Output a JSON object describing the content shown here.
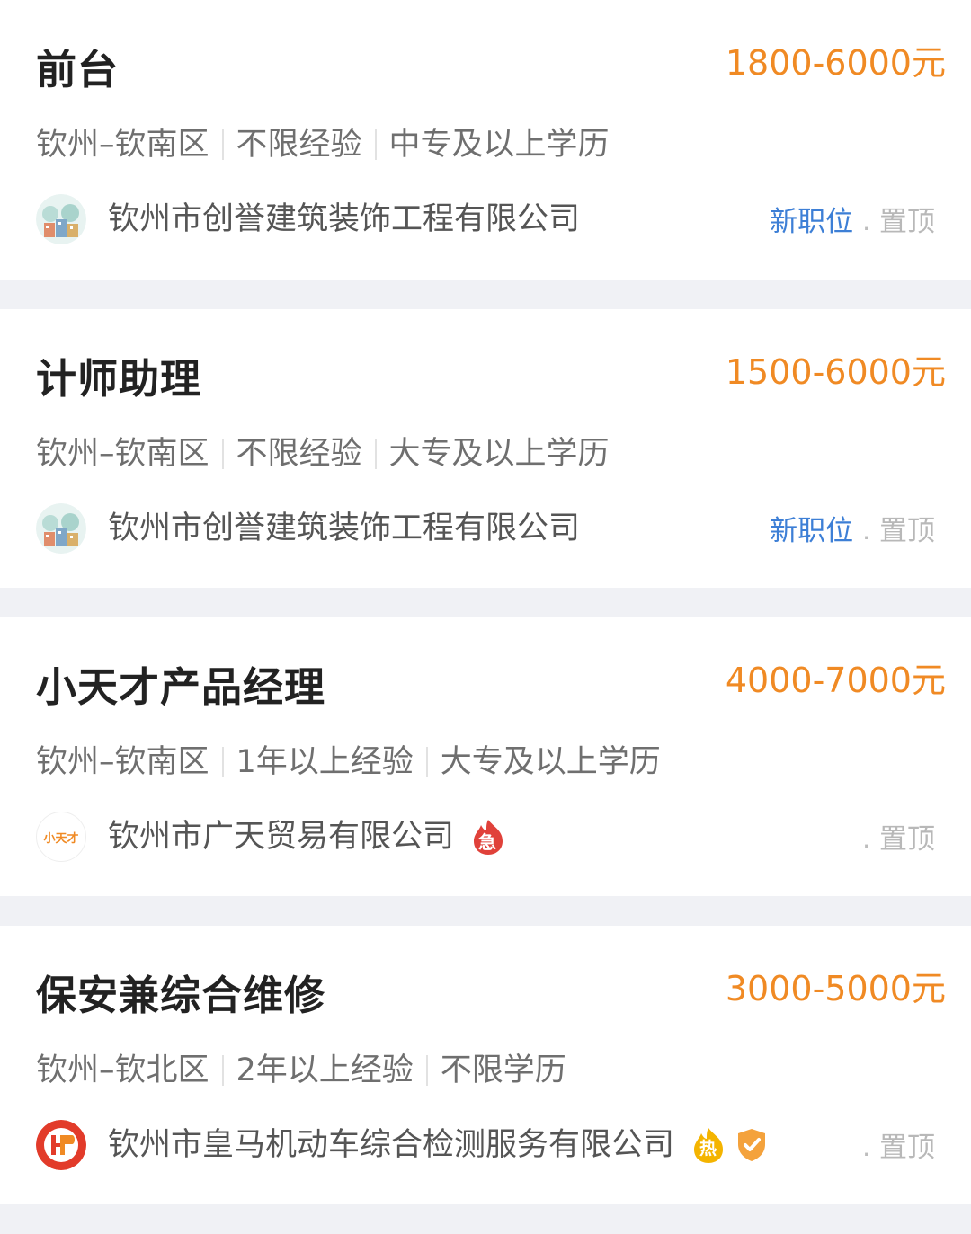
{
  "jobs": [
    {
      "title": "前台",
      "salary": "1800-6000元",
      "location": "钦州–钦南区",
      "experience": "不限经验",
      "education": "中专及以上学历",
      "company": "钦州市创誉建筑装饰工程有限公司",
      "logo_icon": "company-logo-buildings",
      "tag_new": "新职位",
      "dot": ".",
      "tag_top": "置顶"
    },
    {
      "title": "计师助理",
      "salary": "1500-6000元",
      "location": "钦州–钦南区",
      "experience": "不限经验",
      "education": "大专及以上学历",
      "company": "钦州市创誉建筑装饰工程有限公司",
      "logo_icon": "company-logo-buildings",
      "tag_new": "新职位",
      "dot": ".",
      "tag_top": "置顶"
    },
    {
      "title": "小天才产品经理",
      "salary": "4000-7000元",
      "location": "钦州–钦南区",
      "experience": "1年以上经验",
      "education": "大专及以上学历",
      "company": "钦州市广天贸易有限公司",
      "logo_icon": "xiaotiancai-logo",
      "logo_text": "小天才",
      "urgent_badge": "急",
      "dot": ".",
      "tag_top": "置顶"
    },
    {
      "title": "保安兼综合维修",
      "salary": "3000-5000元",
      "location": "钦州–钦北区",
      "experience": "2年以上经验",
      "education": "不限学历",
      "company": "钦州市皇马机动车综合检测服务有限公司",
      "logo_icon": "hm-logo",
      "hot_badge": "热",
      "verified_icon": "verified-shield-icon",
      "dot": ".",
      "tag_top": "置顶"
    }
  ],
  "colors": {
    "salary": "#f08a24",
    "tag_new": "#3d7fd6",
    "background": "#f0f1f5"
  }
}
